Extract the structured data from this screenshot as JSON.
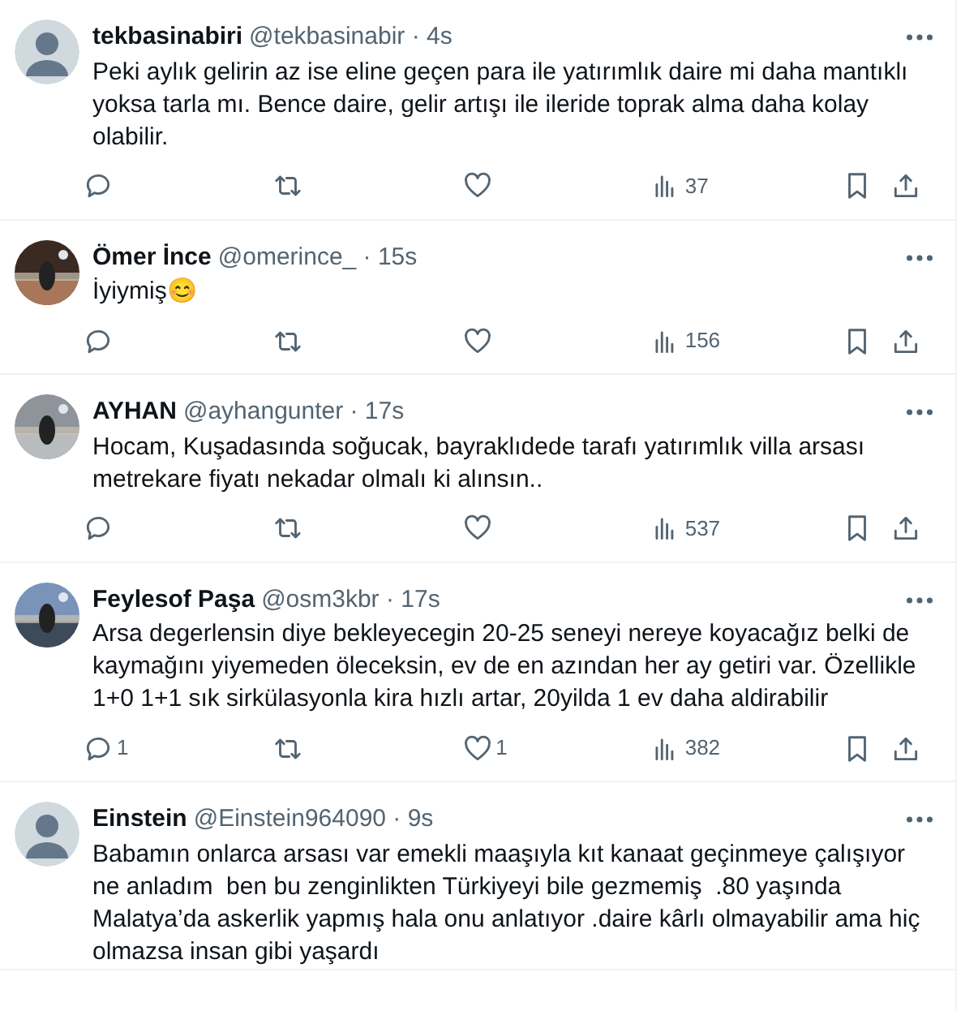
{
  "tweets": [
    {
      "name": "tekbasinabiri",
      "meta": "@tekbasinabir · 4s",
      "avatar": {
        "kind": "default"
      },
      "text": "Peki aylık gelirin az ise eline geçen para ile yatırımlık daire mi daha mantıklı yoksa tarla mı. Bence daire, gelir artışı ile ileride toprak alma daha kolay olabilir.",
      "actions": {
        "views": "37"
      }
    },
    {
      "name": "Ömer İnce",
      "meta": "@omerince_ · 15s",
      "text": "İyiymiş😊",
      "actions": {
        "views": "156"
      }
    },
    {
      "name": "AYHAN",
      "meta": "@ayhangunter · 17s",
      "text": "Hocam, Kuşadasında soğucak, bayraklıdede tarafı yatırımlık villa arsası metrekare fiyatı nekadar olmalı ki alınsın..",
      "actions": {
        "views": "537"
      }
    },
    {
      "name": "Feylesof Paşa",
      "meta": "@osm3kbr · 17s",
      "text": "Arsa degerlensin diye bekleyecegin 20-25 seneyi nereye koyacağız belki de kaymağını yiyemeden öleceksin, ev de en azından her ay getiri var. Özellikle 1+0 1+1 sık sirkülasyonla kira hızlı artar, 20yilda 1 ev daha aldirabilir",
      "actions": {
        "replies": "1",
        "likes": "1",
        "views": "382"
      }
    },
    {
      "name": "Einstein",
      "meta": "@Einstein964090 · 9s",
      "avatar": {
        "kind": "default"
      },
      "text": "Babamın onlarca arsası var emekli maaşıyla kıt kanaat geçinmeye çalışıyor ne anladım  ben bu zenginlikten Türkiyeyi bile gezmemiş  .80 yaşında Malatya’da askerlik yapmış hala onu anlatıyor .daire kârlı olmayabilir ama hiç olmazsa insan gibi yaşardı"
    }
  ]
}
